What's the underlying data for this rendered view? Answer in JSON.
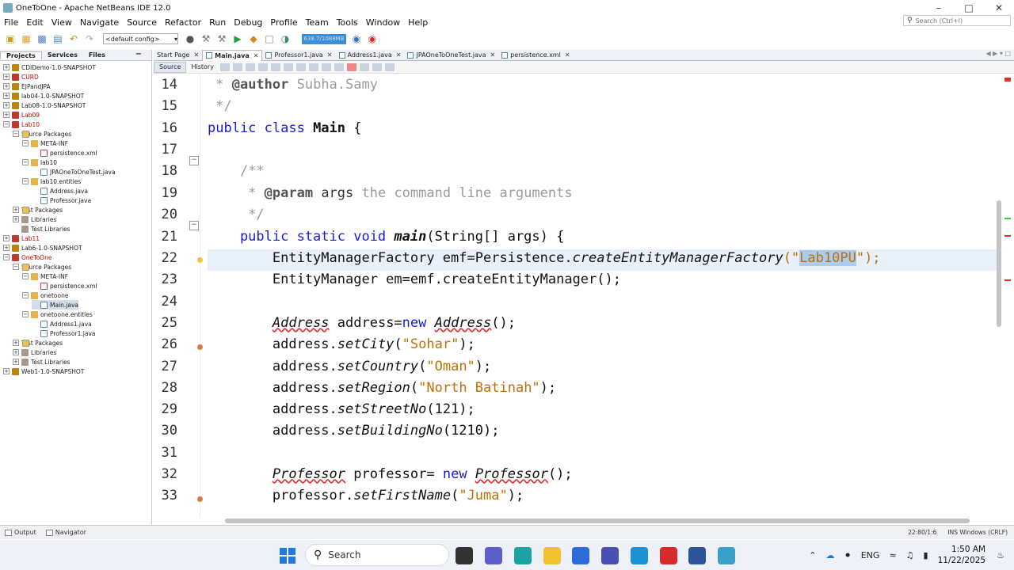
{
  "window": {
    "title": "OneToOne - Apache NetBeans IDE 12.0",
    "controls": [
      "–",
      "□",
      "✕"
    ]
  },
  "menu": [
    "File",
    "Edit",
    "View",
    "Navigate",
    "Source",
    "Refactor",
    "Run",
    "Debug",
    "Profile",
    "Team",
    "Tools",
    "Window",
    "Help"
  ],
  "search": {
    "placeholder": "Search (Ctrl+I)"
  },
  "toolbar": {
    "config": "<default config>",
    "memory": "638.7/1088MB"
  },
  "panel": {
    "tabs": [
      "Projects",
      "Services",
      "Files"
    ],
    "minimize": "−"
  },
  "tree": [
    {
      "label": "CDIDemo-1.0-SNAPSHOT",
      "depth": 0,
      "tg": "+",
      "icon": "proj",
      "red": false
    },
    {
      "label": "CURD",
      "depth": 0,
      "tg": "+",
      "icon": "projr",
      "red": true
    },
    {
      "label": "EJPandJPA",
      "depth": 0,
      "tg": "+",
      "icon": "proj",
      "red": false
    },
    {
      "label": "lab04-1.0-SNAPSHOT",
      "depth": 0,
      "tg": "+",
      "icon": "proj",
      "red": false
    },
    {
      "label": "Lab08-1.0-SNAPSHOT",
      "depth": 0,
      "tg": "+",
      "icon": "proj",
      "red": false
    },
    {
      "label": "Lab09",
      "depth": 0,
      "tg": "+",
      "icon": "projr",
      "red": true
    },
    {
      "label": "Lab10",
      "depth": 0,
      "tg": "−",
      "icon": "projr",
      "red": true
    },
    {
      "label": "Source Packages",
      "depth": 1,
      "tg": "−",
      "icon": "fold",
      "red": false
    },
    {
      "label": "META-INF",
      "depth": 2,
      "tg": "−",
      "icon": "pkg",
      "red": false
    },
    {
      "label": "persistence.xml",
      "depth": 3,
      "tg": "",
      "icon": "xml",
      "red": false
    },
    {
      "label": "lab10",
      "depth": 2,
      "tg": "−",
      "icon": "pkg",
      "red": false
    },
    {
      "label": "JPAOneToOneTest.java",
      "depth": 3,
      "tg": "",
      "icon": "java",
      "red": false
    },
    {
      "label": "lab10.entities",
      "depth": 2,
      "tg": "−",
      "icon": "pkg",
      "red": false
    },
    {
      "label": "Address.java",
      "depth": 3,
      "tg": "",
      "icon": "java",
      "red": false
    },
    {
      "label": "Professor.java",
      "depth": 3,
      "tg": "",
      "icon": "java",
      "red": false
    },
    {
      "label": "Test Packages",
      "depth": 1,
      "tg": "+",
      "icon": "fold",
      "red": false
    },
    {
      "label": "Libraries",
      "depth": 1,
      "tg": "+",
      "icon": "lib",
      "red": false
    },
    {
      "label": "Test Libraries",
      "depth": 1,
      "tg": "",
      "icon": "lib",
      "red": false
    },
    {
      "label": "Lab11",
      "depth": 0,
      "tg": "+",
      "icon": "projr",
      "red": true
    },
    {
      "label": "Lab6-1.0-SNAPSHOT",
      "depth": 0,
      "tg": "+",
      "icon": "proj",
      "red": false
    },
    {
      "label": "OneToOne",
      "depth": 0,
      "tg": "−",
      "icon": "projr",
      "red": true
    },
    {
      "label": "Source Packages",
      "depth": 1,
      "tg": "−",
      "icon": "fold",
      "red": false
    },
    {
      "label": "META-INF",
      "depth": 2,
      "tg": "−",
      "icon": "pkg",
      "red": false
    },
    {
      "label": "persistence.xml",
      "depth": 3,
      "tg": "",
      "icon": "xml",
      "red": false
    },
    {
      "label": "onetoone",
      "depth": 2,
      "tg": "−",
      "icon": "pkg",
      "red": false
    },
    {
      "label": "Main.java",
      "depth": 3,
      "tg": "",
      "icon": "java",
      "red": false,
      "selected": true
    },
    {
      "label": "onetoone.entities",
      "depth": 2,
      "tg": "−",
      "icon": "pkg",
      "red": false
    },
    {
      "label": "Address1.java",
      "depth": 3,
      "tg": "",
      "icon": "java",
      "red": false
    },
    {
      "label": "Professor1.java",
      "depth": 3,
      "tg": "",
      "icon": "java",
      "red": false
    },
    {
      "label": "Test Packages",
      "depth": 1,
      "tg": "+",
      "icon": "fold",
      "red": false
    },
    {
      "label": "Libraries",
      "depth": 1,
      "tg": "+",
      "icon": "lib",
      "red": false
    },
    {
      "label": "Test Libraries",
      "depth": 1,
      "tg": "+",
      "icon": "lib",
      "red": false
    },
    {
      "label": "Web1-1.0-SNAPSHOT",
      "depth": 0,
      "tg": "+",
      "icon": "proj",
      "red": false
    }
  ],
  "editor_tabs": [
    {
      "label": "Start Page",
      "active": false
    },
    {
      "label": "Main.java",
      "active": true
    },
    {
      "label": "Professor1.java",
      "active": false
    },
    {
      "label": "Address1.java",
      "active": false
    },
    {
      "label": "JPAOneToOneTest.java",
      "active": false
    },
    {
      "label": "persistence.xml",
      "active": false
    }
  ],
  "editor_subtabs": [
    "Source",
    "History"
  ],
  "line_numbers": [
    "14",
    "15",
    "16",
    "17",
    "18",
    "19",
    "20",
    "21",
    "22",
    "23",
    "24",
    "25",
    "26",
    "27",
    "28",
    "29",
    "30",
    "31",
    "32",
    "33"
  ],
  "code": {
    "l14_a": " * ",
    "l14_b": "@author",
    "l14_c": " Subha.Samy",
    "l15": " */",
    "l16_a": "public class ",
    "l16_b": "Main",
    "l16_c": " {",
    "l18": "    /**",
    "l19_a": "     * ",
    "l19_b": "@param",
    "l19_c": " args",
    "l19_d": " the command line arguments",
    "l20": "     */",
    "l21_a": "    public static void ",
    "l21_b": "main",
    "l21_c": "(String[] args) {",
    "l22_a": "        EntityManagerFactory emf=Persistence.",
    "l22_b": "createEntityManagerFactory",
    "l22_c": "(\"",
    "l22_d": "Lab10PU",
    "l22_e": "\");",
    "l23": "        EntityManager em=emf.createEntityManager();",
    "l25_a": "        ",
    "l25_b": "Address",
    "l25_c": " address=",
    "l25_d": "new",
    "l25_e": " ",
    "l25_f": "Address",
    "l25_g": "();",
    "l26_a": "        address.",
    "l26_b": "setCity",
    "l26_c": "(",
    "l26_d": "\"Sohar\"",
    "l26_e": ");",
    "l27_a": "        address.",
    "l27_b": "setCountry",
    "l27_c": "(",
    "l27_d": "\"Oman\"",
    "l27_e": ");",
    "l28_a": "        address.",
    "l28_b": "setRegion",
    "l28_c": "(",
    "l28_d": "\"North Batinah\"",
    "l28_e": ");",
    "l29_a": "        address.",
    "l29_b": "setStreetNo",
    "l29_c": "(121);",
    "l30_a": "        address.",
    "l30_b": "setBuildingNo",
    "l30_c": "(1210);",
    "l32_a": "        ",
    "l32_b": "Professor",
    "l32_c": " professor= ",
    "l32_d": "new",
    "l32_e": " ",
    "l32_f": "Professor",
    "l32_g": "();",
    "l33_a": "        professor.",
    "l33_b": "setFirstName",
    "l33_c": "(",
    "l33_d": "\"Juma\"",
    "l33_e": ");"
  },
  "status": {
    "output": "Output",
    "navigator": "Navigator",
    "position": "22:80/1:6",
    "mode": "INS Windows (CRLF)"
  },
  "taskbar": {
    "search": "Search",
    "lang": "ENG",
    "time": "1:50 AM",
    "date": "11/22/2025"
  }
}
